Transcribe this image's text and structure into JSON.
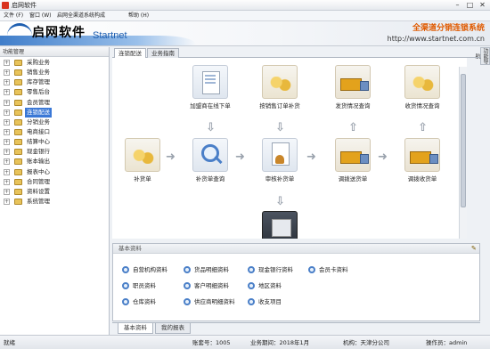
{
  "window": {
    "title": "启网软件"
  },
  "menu": {
    "items": [
      "文件 (F)",
      "窗口 (W)",
      "启网全渠道系统构成",
      "帮助 (H)"
    ]
  },
  "banner": {
    "logo_cn": "启网软件",
    "logo_en": "Startnet",
    "slogan": "全渠道分销连锁系统",
    "url": "http://www.startnet.com.cn"
  },
  "sidebar": {
    "header": "功能管理",
    "items": [
      {
        "label": "采购业务",
        "selected": false
      },
      {
        "label": "销售业务",
        "selected": false
      },
      {
        "label": "库存管理",
        "selected": false
      },
      {
        "label": "零售后台",
        "selected": false
      },
      {
        "label": "会员管理",
        "selected": false
      },
      {
        "label": "连锁配送",
        "selected": true
      },
      {
        "label": "分销业务",
        "selected": false
      },
      {
        "label": "电商接口",
        "selected": false
      },
      {
        "label": "结算中心",
        "selected": false
      },
      {
        "label": "现金银行",
        "selected": false
      },
      {
        "label": "账本输出",
        "selected": false
      },
      {
        "label": "报表中心",
        "selected": false
      },
      {
        "label": "合同管理",
        "selected": false
      },
      {
        "label": "资料设置",
        "selected": false
      },
      {
        "label": "系统管理",
        "selected": false
      }
    ]
  },
  "right_tab": {
    "label": "功能导航"
  },
  "content_tabs": [
    {
      "label": "连锁配送",
      "active": true
    },
    {
      "label": "业务指南",
      "active": false
    }
  ],
  "flow": {
    "nodes": {
      "add_online": "加盟商在线下单",
      "order_replenish": "按销售订单补货",
      "ship_query": "发货情况查询",
      "receive_query": "收货情况查询",
      "replenish": "补货单",
      "replenish_query": "补货单查询",
      "audit": "审核补货单",
      "transfer": "调拨送货单",
      "transfer_receive": "调拨收货单"
    },
    "arrow_right": "➜",
    "arrow_down": "⇩",
    "arrow_up": "⇧"
  },
  "info": {
    "header": "基本资料",
    "links": [
      "自营机构资料",
      "货品明细资料",
      "现金银行资料",
      "会员卡资料",
      "职员资料",
      "客户明细资料",
      "地区资料",
      "仓库资料",
      "供应商明细资料",
      "收支项目"
    ]
  },
  "bottom_tabs": [
    {
      "label": "基本资料",
      "active": true
    },
    {
      "label": "我的报表",
      "active": false
    }
  ],
  "status": {
    "ready": "就绪",
    "account": "账套号：1005",
    "period": "业务期间：2018年1月",
    "org": "机构：天津分公司",
    "operator": "操作员：admin"
  }
}
